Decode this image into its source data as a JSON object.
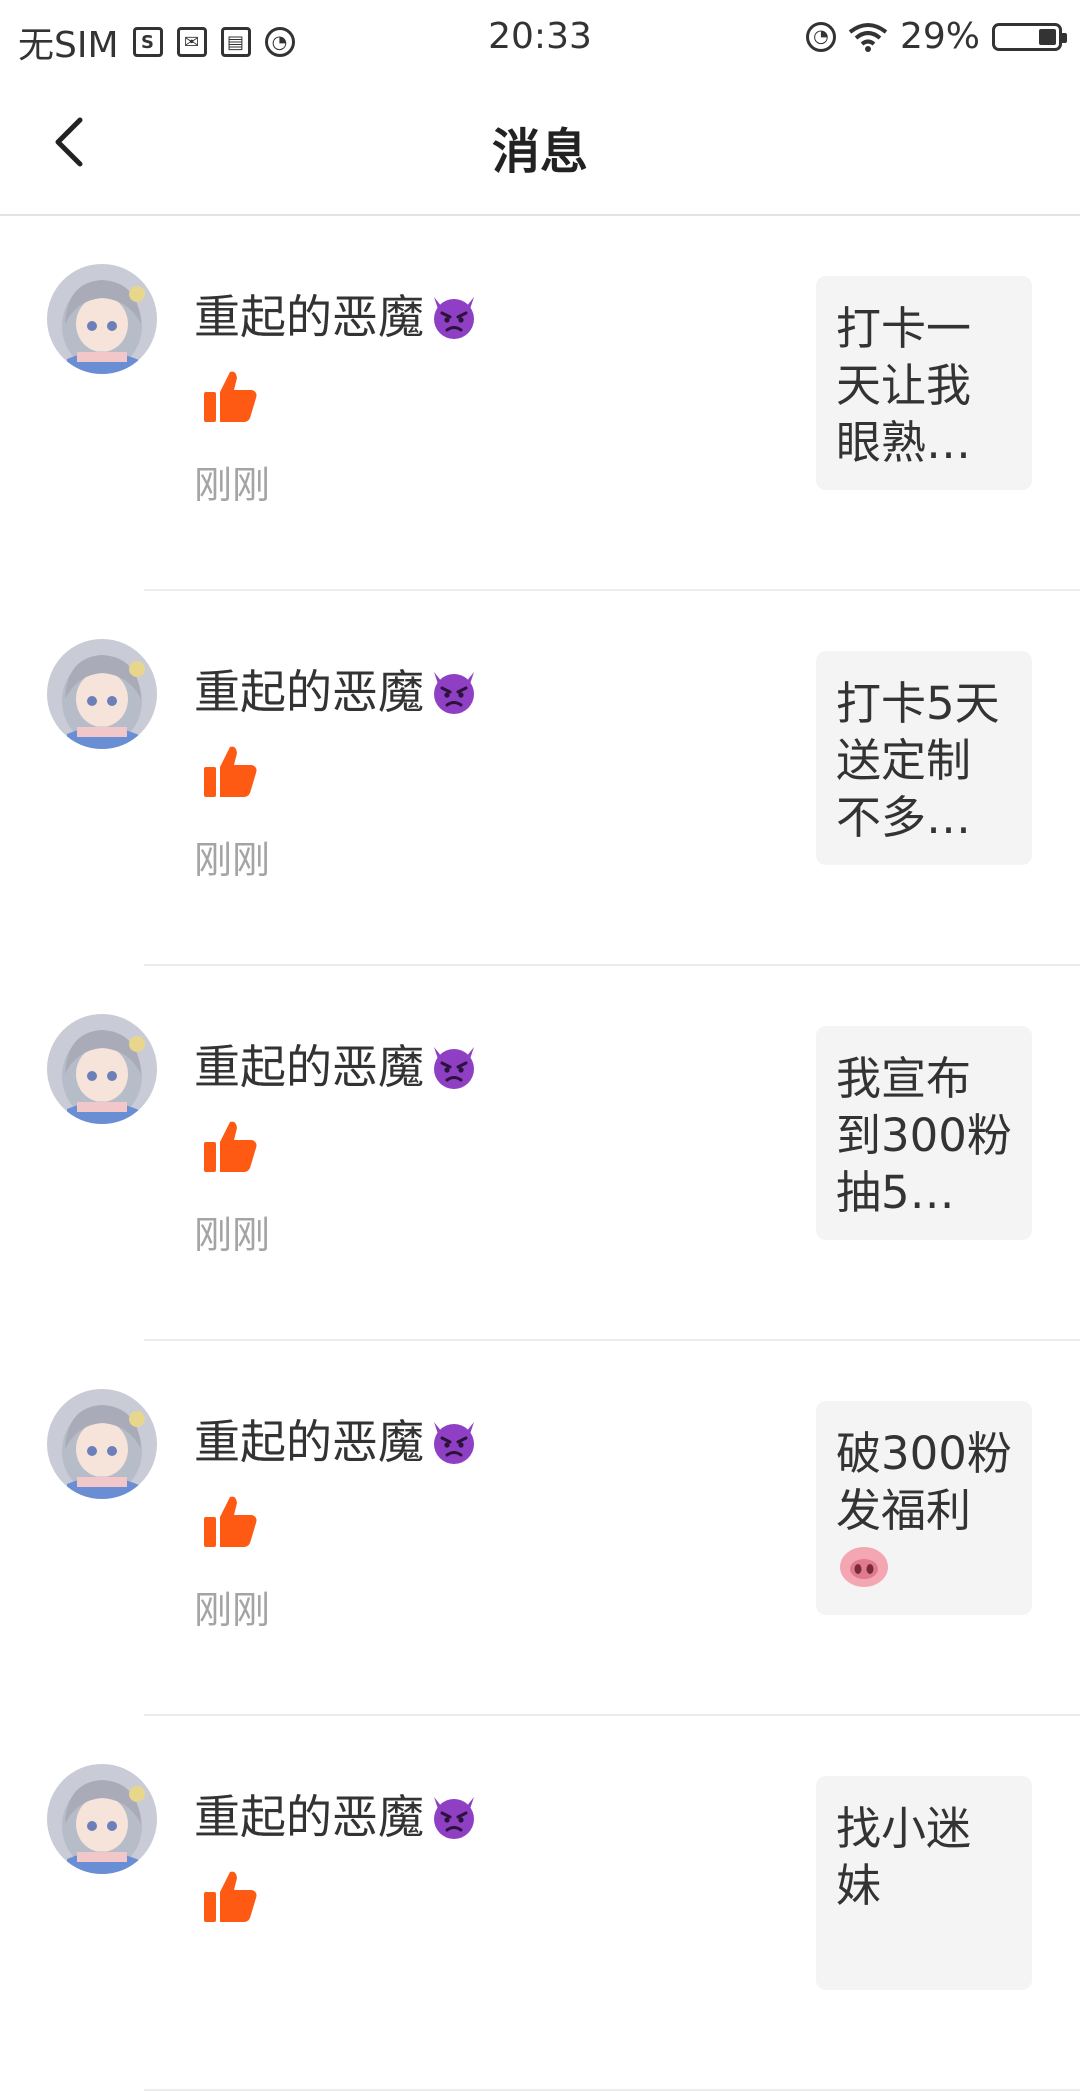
{
  "status_bar": {
    "carrier": "无SIM",
    "time": "20:33",
    "battery": "29%",
    "battery_level": 0.29
  },
  "header": {
    "title": "消息",
    "back_icon": "chevron-left-icon"
  },
  "messages": [
    {
      "username": "重起的恶魔",
      "username_emoji": "angry-devil-emoji",
      "action_icon": "thumbs-up-icon",
      "time": "刚刚",
      "preview": "打卡一天让我眼熟…"
    },
    {
      "username": "重起的恶魔",
      "username_emoji": "angry-devil-emoji",
      "action_icon": "thumbs-up-icon",
      "time": "刚刚",
      "preview": "打卡5天送定制不多…"
    },
    {
      "username": "重起的恶魔",
      "username_emoji": "angry-devil-emoji",
      "action_icon": "thumbs-up-icon",
      "time": "刚刚",
      "preview": "我宣布到300粉抽5…"
    },
    {
      "username": "重起的恶魔",
      "username_emoji": "angry-devil-emoji",
      "action_icon": "thumbs-up-icon",
      "time": "刚刚",
      "preview": "破300粉发福利",
      "preview_emoji": "pig-nose-emoji"
    },
    {
      "username": "重起的恶魔",
      "username_emoji": "angry-devil-emoji",
      "action_icon": "thumbs-up-icon",
      "time": "",
      "preview": "找小迷妹"
    }
  ],
  "colors": {
    "like_orange": "#ff5a14",
    "devil_purple": "#8e3fc4",
    "preview_bg": "#f4f4f4",
    "time_gray": "#a4a4a4"
  }
}
